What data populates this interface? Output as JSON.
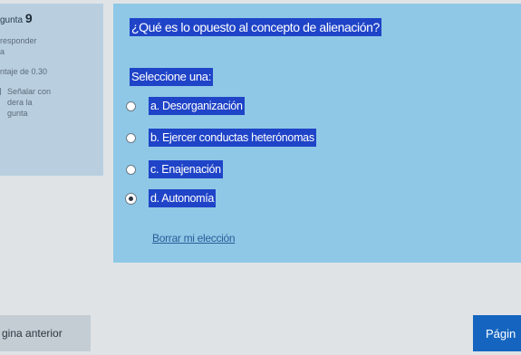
{
  "info": {
    "question_prefix": "gunta",
    "question_number": "9",
    "status": "responder",
    "status_extra": "a",
    "score": "ntaje de 0.30",
    "flag_label_1": "Señalar con",
    "flag_label_2": "dera la",
    "flag_label_3": "gunta"
  },
  "question": {
    "text": "¿Qué es lo opuesto al concepto de alienación?",
    "prompt": "Seleccione una:",
    "options": [
      {
        "label": "a. Desorganización",
        "selected": false
      },
      {
        "label": "b. Ejercer conductas heterónomas",
        "selected": false
      },
      {
        "label": "c. Enajenación",
        "selected": false
      },
      {
        "label": "d. Autonomía",
        "selected": true
      }
    ],
    "clear_link": "Borrar mi elección"
  },
  "navigation": {
    "prev_label": "gina anterior",
    "next_label": "Págin"
  },
  "colors": {
    "panel": "#8ec8e6",
    "info_panel": "#b9cfe0",
    "selection": "#1f44c8",
    "next_button": "#1565c0"
  }
}
